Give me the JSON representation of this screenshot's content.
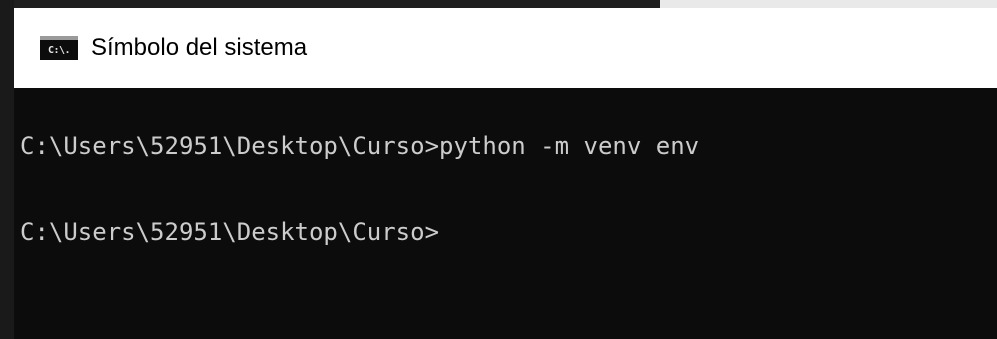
{
  "window": {
    "title": "Símbolo del sistema",
    "icon": "cmd-console-icon",
    "icon_text": "C:\\."
  },
  "console": {
    "lines": [
      "C:\\Users\\52951\\Desktop\\Curso>python -m venv env",
      "",
      "C:\\Users\\52951\\Desktop\\Curso>"
    ]
  },
  "colors": {
    "console_bg": "#0c0c0c",
    "console_fg": "#cccccc",
    "titlebar_bg": "#ffffff"
  }
}
